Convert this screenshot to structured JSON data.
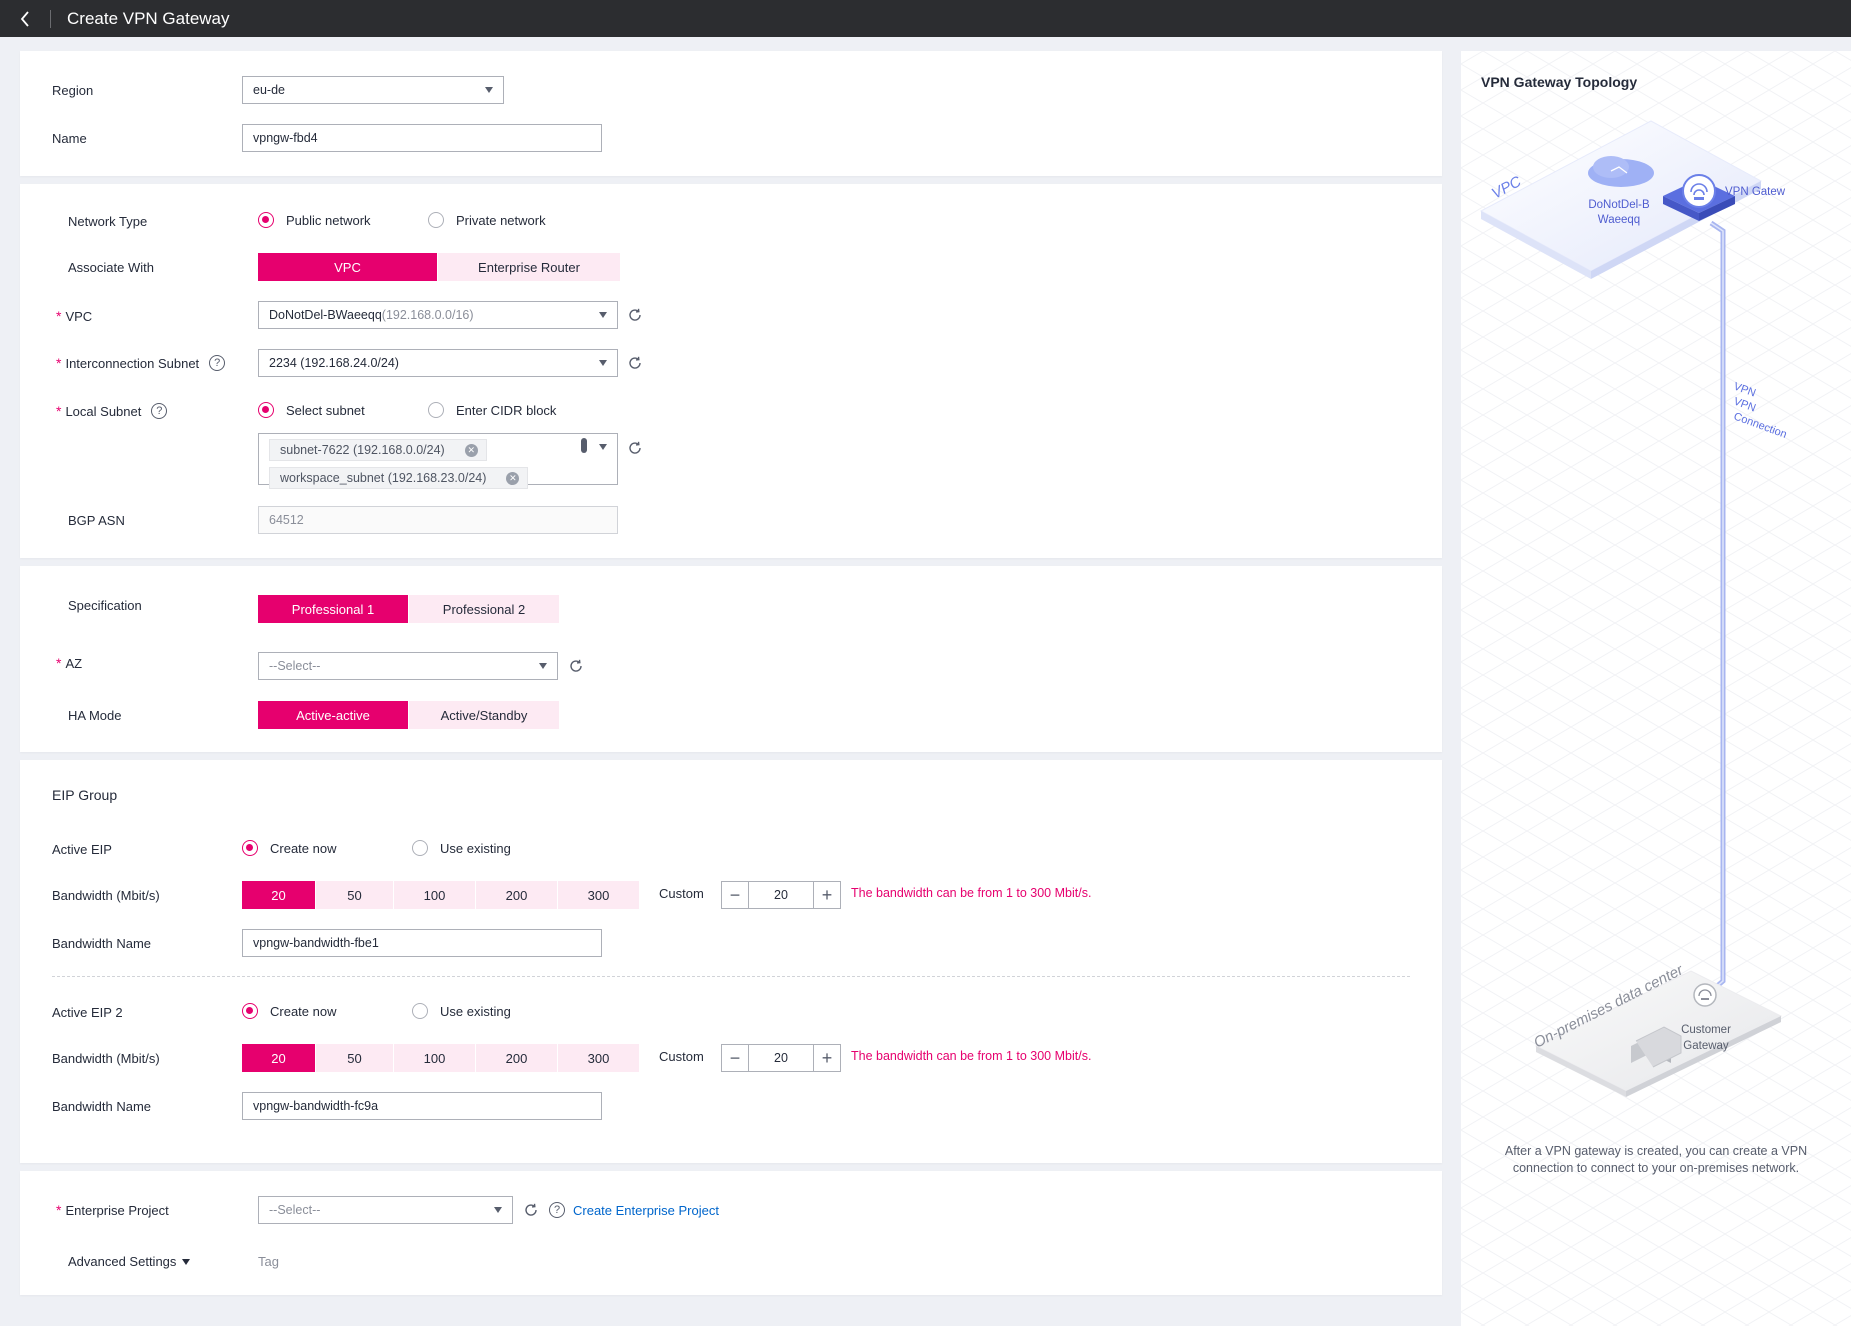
{
  "header": {
    "title": "Create VPN Gateway",
    "back_icon": "chevron-left-icon"
  },
  "basic": {
    "region_label": "Region",
    "region_value": "eu-de",
    "name_label": "Name",
    "name_value": "vpngw-fbd4"
  },
  "network": {
    "network_type_label": "Network Type",
    "network_type_options": [
      "Public network",
      "Private network"
    ],
    "network_type_selected": "Public network",
    "associate_label": "Associate With",
    "associate_options": [
      "VPC",
      "Enterprise Router"
    ],
    "associate_selected": "VPC",
    "vpc_label": "VPC",
    "vpc_name": "DoNotDel-BWaeeqq",
    "vpc_cidr": "(192.168.0.0/16)",
    "subnet_label": "Interconnection Subnet",
    "subnet_value": "2234 (192.168.24.0/24)",
    "local_subnet_label": "Local Subnet",
    "local_subnet_options": [
      "Select subnet",
      "Enter CIDR block"
    ],
    "local_subnet_selected": "Select subnet",
    "local_subnets": [
      "subnet-7622 (192.168.0.0/24)",
      "workspace_subnet (192.168.23.0/24)"
    ],
    "bgp_label": "BGP ASN",
    "bgp_value": "64512"
  },
  "spec": {
    "spec_label": "Specification",
    "spec_options": [
      "Professional 1",
      "Professional 2"
    ],
    "spec_selected": "Professional 1",
    "az_label": "AZ",
    "az_placeholder": "--Select--",
    "ha_label": "HA Mode",
    "ha_options": [
      "Active-active",
      "Active/Standby"
    ],
    "ha_selected": "Active-active"
  },
  "eip": {
    "group_title": "EIP Group",
    "eip1": {
      "label": "Active EIP",
      "options": [
        "Create now",
        "Use existing"
      ],
      "selected": "Create now",
      "bw_label": "Bandwidth (Mbit/s)",
      "bw_options": [
        "20",
        "50",
        "100",
        "200",
        "300"
      ],
      "bw_selected": "20",
      "custom_label": "Custom",
      "custom_value": "20",
      "hint": "The bandwidth can be from 1 to 300 Mbit/s.",
      "name_label": "Bandwidth Name",
      "name_value": "vpngw-bandwidth-fbe1"
    },
    "eip2": {
      "label": "Active EIP 2",
      "options": [
        "Create now",
        "Use existing"
      ],
      "selected": "Create now",
      "bw_label": "Bandwidth (Mbit/s)",
      "bw_options": [
        "20",
        "50",
        "100",
        "200",
        "300"
      ],
      "bw_selected": "20",
      "custom_label": "Custom",
      "custom_value": "20",
      "hint": "The bandwidth can be from 1 to 300 Mbit/s.",
      "name_label": "Bandwidth Name",
      "name_value": "vpngw-bandwidth-fc9a"
    }
  },
  "project": {
    "label": "Enterprise Project",
    "placeholder": "--Select--",
    "create_link": "Create Enterprise Project",
    "advanced_label": "Advanced Settings",
    "tag_label": "Tag"
  },
  "topology": {
    "title": "VPN Gateway Topology",
    "vpc_text": "VPC",
    "vpc_name_line1": "DoNotDel-B",
    "vpc_name_line2": "Waeeqq",
    "gateway_label": "VPN Gatew",
    "conn_line1": "VPN",
    "conn_line2": "VPN",
    "conn_line3": "Connection",
    "dc_text": "On-premises data center",
    "cgw_line1": "Customer",
    "cgw_line2": "Gateway",
    "description": "After a VPN gateway is created, you can create a VPN connection to connect to your on-premises network.",
    "colors": {
      "accent": "#e6006e",
      "link": "#0066cc",
      "topo_blue": "#6b80e8"
    }
  }
}
